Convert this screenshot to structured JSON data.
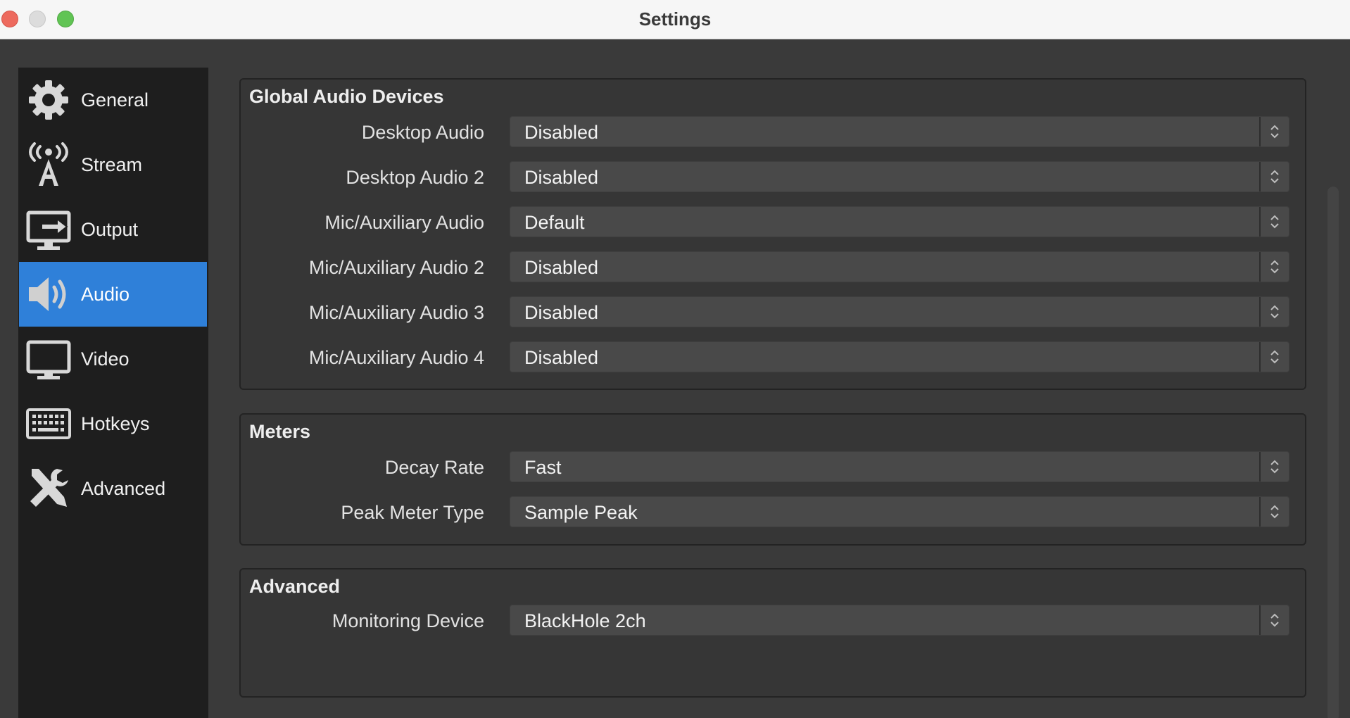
{
  "window": {
    "title": "Settings"
  },
  "sidebar": {
    "items": [
      {
        "label": "General",
        "icon": "gear-icon",
        "active": false
      },
      {
        "label": "Stream",
        "icon": "broadcast-antenna-icon",
        "active": false
      },
      {
        "label": "Output",
        "icon": "output-monitor-icon",
        "active": false
      },
      {
        "label": "Audio",
        "icon": "speaker-icon",
        "active": true
      },
      {
        "label": "Video",
        "icon": "monitor-icon",
        "active": false
      },
      {
        "label": "Hotkeys",
        "icon": "keyboard-icon",
        "active": false
      },
      {
        "label": "Advanced",
        "icon": "tools-icon",
        "active": false
      }
    ]
  },
  "groups": {
    "global": {
      "title": "Global Audio Devices",
      "rows": [
        {
          "label": "Desktop Audio",
          "value": "Disabled"
        },
        {
          "label": "Desktop Audio 2",
          "value": "Disabled"
        },
        {
          "label": "Mic/Auxiliary Audio",
          "value": "Default"
        },
        {
          "label": "Mic/Auxiliary Audio 2",
          "value": "Disabled"
        },
        {
          "label": "Mic/Auxiliary Audio 3",
          "value": "Disabled"
        },
        {
          "label": "Mic/Auxiliary Audio 4",
          "value": "Disabled"
        }
      ]
    },
    "meters": {
      "title": "Meters",
      "rows": [
        {
          "label": "Decay Rate",
          "value": "Fast"
        },
        {
          "label": "Peak Meter Type",
          "value": "Sample Peak"
        }
      ]
    },
    "advanced": {
      "title": "Advanced",
      "rows": [
        {
          "label": "Monitoring Device",
          "value": "BlackHole 2ch"
        }
      ]
    }
  },
  "colors": {
    "accent": "#2f80d9",
    "sidebar_bg": "#1e1e1e",
    "window_bg": "#3a3a3a",
    "select_bg": "#494949"
  }
}
